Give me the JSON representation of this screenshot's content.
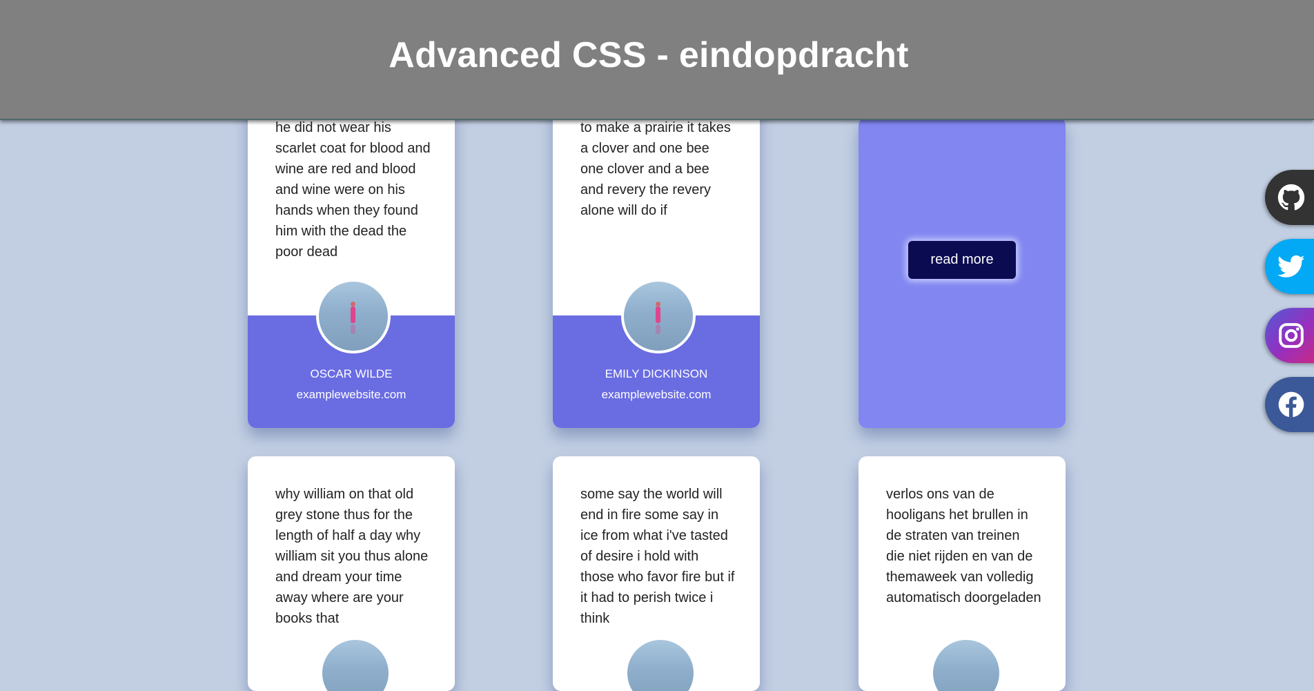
{
  "header": {
    "title": "Advanced CSS - eindopdracht"
  },
  "cards_top": [
    {
      "quote": "he did not wear his scarlet coat for blood and wine are red and blood and wine were on his hands when they found him with the dead the poor dead",
      "author": "OSCAR WILDE",
      "site": "examplewebsite.com"
    },
    {
      "quote": "to make a prairie it takes a clover and one bee one clover and a bee and revery the revery alone will do if",
      "author": "EMILY DICKINSON",
      "site": "examplewebsite.com"
    },
    {
      "button": "read more"
    }
  ],
  "cards_bottom": [
    {
      "quote": "why william on that old grey stone thus for the length of half a day why william sit you thus alone and dream your time away where are your books that"
    },
    {
      "quote": "some say the world will end in fire some say in ice from what i've tasted of desire i hold with those who favor fire but if it had to perish twice i think"
    },
    {
      "quote": "verlos ons van de hooligans het brullen in de straten van treinen die niet rijden en van de themaweek van volledig automatisch doorgeladen"
    }
  ],
  "social": [
    {
      "icon": "github-icon",
      "color": "#333333"
    },
    {
      "icon": "twitter-icon",
      "color": "#03a9f4"
    },
    {
      "icon": "instagram-icon",
      "color": "#8a3ab9"
    },
    {
      "icon": "facebook-icon",
      "color": "#3b5998"
    }
  ],
  "colors": {
    "background": "#c2cfe3",
    "header": "#808080",
    "card_accent": "#6a6ce2",
    "readmore_card": "#8186f1",
    "button": "#0b0b52"
  }
}
